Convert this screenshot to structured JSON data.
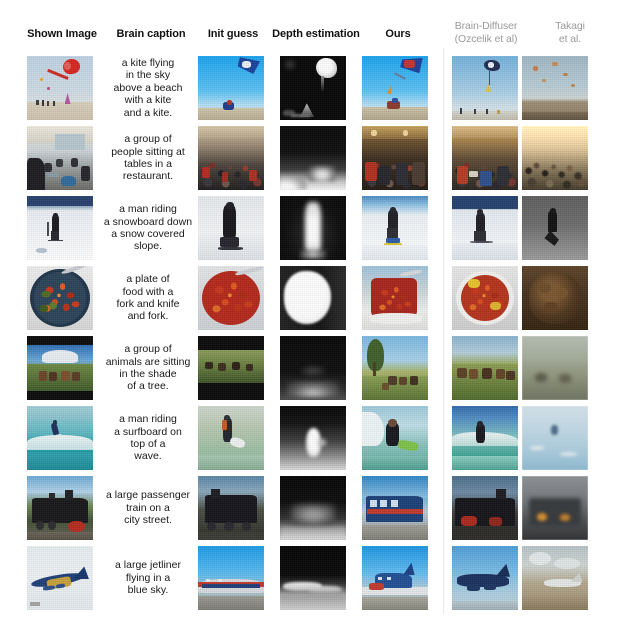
{
  "figure": {
    "kind": "qualitative-comparison-grid",
    "background_color": "#ffffff",
    "header_color": "#111111",
    "header_muted_color": "#9a9a9a",
    "caption_color": "#1a1a1a",
    "columns": [
      {
        "id": "shown_image",
        "label": "Shown Image",
        "sublabel": "",
        "muted": false
      },
      {
        "id": "brain_caption",
        "label": "Brain caption",
        "sublabel": "",
        "muted": false
      },
      {
        "id": "init_guess",
        "label": "Init guess",
        "sublabel": "",
        "muted": false
      },
      {
        "id": "depth",
        "label": "Depth estimation",
        "sublabel": "",
        "muted": false
      },
      {
        "id": "ours",
        "label": "Ours",
        "sublabel": "",
        "muted": false
      },
      {
        "id": "brain_diffuser",
        "label": "Brain-Diffuser",
        "sublabel": "(Ozcelik et al)",
        "muted": true
      },
      {
        "id": "takagi",
        "label": "Takagi",
        "sublabel": "et al.",
        "muted": true
      }
    ],
    "rows": [
      {
        "id": "kite",
        "caption": "a kite flying\nin the sky\nabove a beach\nwith a kite\nand a kite.",
        "shown_image_alt": "red heart-shaped kite flying over a beach",
        "init_guess_alt": "blue kite in bright blue sky over beach",
        "depth_alt": "black depth map with bright kite blob top right",
        "ours_alt": "blue and red kite in blue sky above beach",
        "brain_diffuser_alt": "dark kite high in pale blue sky over sand",
        "takagi_alt": "hazy beach sky with small orange kites"
      },
      {
        "id": "restaurant",
        "caption": "a group of\npeople sitting at\ntables in a\nrestaurant.",
        "shown_image_alt": "people seated at tables in a bright cafeteria",
        "init_guess_alt": "dense crowd of seated people",
        "depth_alt": "dark depth map fading to white at bottom",
        "ours_alt": "warm restaurant interior with many seated people",
        "brain_diffuser_alt": "warm indoor scene with crowd at tables",
        "takagi_alt": "sepia blurred crowd of people"
      },
      {
        "id": "snowboard",
        "caption": "a man riding\na snowboard down\na snow covered\nslope.",
        "shown_image_alt": "person on snowy slope under dark blue sky",
        "init_guess_alt": "dark figure standing on snow",
        "depth_alt": "black depth map with vertical white column",
        "ours_alt": "snowboarder on white snow slope",
        "brain_diffuser_alt": "skier on snow with dark blue sky band",
        "takagi_alt": "gray silhouette of a person on snow"
      },
      {
        "id": "plate",
        "caption": "a plate of\nfood with a\nfork and knife\nand fork.",
        "shown_image_alt": "bowl of carrots and broccoli with a spoon",
        "init_guess_alt": "red chopped food on a white plate",
        "depth_alt": "white rounded blob depth map on black",
        "ours_alt": "tall mound of red food on white plate",
        "brain_diffuser_alt": "red and yellow food on a white plate",
        "takagi_alt": "dark brown textured food close-up"
      },
      {
        "id": "animals",
        "caption": "a group of\nanimals are sitting\nin the shade\nof a tree.",
        "shown_image_alt": "horses grazing on a green hill with mountain",
        "init_guess_alt": "dark field with green grass and animals",
        "depth_alt": "dark depth map with faint bright foreground",
        "ours_alt": "animals on grass under a blue sky and tree",
        "brain_diffuser_alt": "herd of animals in green field",
        "takagi_alt": "blurry gray-green landscape"
      },
      {
        "id": "surfer",
        "caption": "a man riding\na surfboard on\ntop of a\nwave.",
        "shown_image_alt": "surfer riding a teal ocean wave",
        "init_guess_alt": "person with surfboard near water",
        "depth_alt": "black to white gradient with white surfer blob",
        "ours_alt": "surfer in wetsuit on a board in the water",
        "brain_diffuser_alt": "surfer on breaking wave",
        "takagi_alt": "pale blue water with distant surfer"
      },
      {
        "id": "train",
        "caption": "a large passenger\ntrain on a\ncity street.",
        "shown_image_alt": "black steam locomotive on tracks",
        "init_guess_alt": "dark train engine on rails",
        "depth_alt": "black depth map with soft gray train shape",
        "ours_alt": "blue and red train at a platform",
        "brain_diffuser_alt": "dark locomotive with red details",
        "takagi_alt": "gray blurry train with warm lights"
      },
      {
        "id": "jetliner",
        "caption": "a large jetliner\nflying in a\nblue sky.",
        "shown_image_alt": "blue and gold jetliner flying in pale sky",
        "init_guess_alt": "red and white airliner under blue sky",
        "depth_alt": "black sky with white fuselage band depth map",
        "ours_alt": "blue airliner on tarmac under blue sky",
        "brain_diffuser_alt": "dark blue airplane in blue sky",
        "takagi_alt": "white plane over tan ground with clouds"
      }
    ]
  }
}
